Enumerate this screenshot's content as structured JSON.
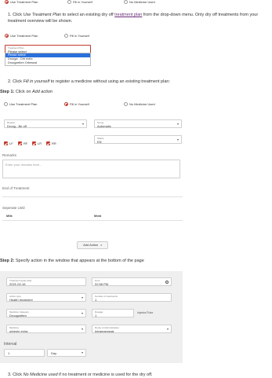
{
  "top_strip": {
    "opt_treatment": "Use Treatment Plan",
    "opt_fill": "Fill in Yourself",
    "opt_none": "No Medicine Used"
  },
  "step1_intro": {
    "num": "1.",
    "pre": "Click ",
    "em": "Use Treatment Plan",
    "mid": " to select an existing dry off ",
    "link": "treatment plan",
    "post": " from the drop-down menu. Only dry off treatments from your treatment overview will be shown."
  },
  "shot1": {
    "opt_treatment": "Use Treatment Plan",
    "opt_fill": "Fill in Yourself",
    "field_label": "Treatment Plan",
    "field_value": "Please select",
    "options": [
      "Please select",
      "Drooga . Orb extra",
      "Droogzetten Orbeseal"
    ],
    "selected_index": 0
  },
  "step2_intro": {
    "num": "2.",
    "pre": "Click ",
    "em": "Fill in yourself",
    "post": " to register a medicine without using an existing treatment plan:"
  },
  "step1_heading": {
    "bold": "Step 1:",
    "pre": " Click on ",
    "em": "Add action"
  },
  "shot2": {
    "opt_treatment": "Use Treatment Plan",
    "opt_fill": "Fill in Yourself",
    "opt_none": "No Medicine Used",
    "reason_label": "Reason",
    "reason_value": "Droog - Be off",
    "group_label": "Group",
    "group_value": "Automatic",
    "quarters": [
      "LF",
      "RF",
      "LR",
      "RR"
    ],
    "status_label": "Status",
    "status_value": "EN",
    "remarks_label": "Remarks",
    "remarks_placeholder": "Enter your remarks here...",
    "end_label": "End of Treatment",
    "separate_label": "Seperate Until",
    "milk_label": "Milk",
    "meat_label": "Meat",
    "add_action": "Add Action"
  },
  "step2_heading": {
    "bold": "Step 2:",
    "text": " Specify action in the window that appears at the bottom of the page"
  },
  "shot3": {
    "date_label": "Treatment apply date",
    "date_value": "2021-02-16",
    "hour_label": "Hour",
    "hour_value": "02:58 PM",
    "action_label": "Action type",
    "action_value": "Health treatment",
    "num_label": "Number of treatments",
    "num_value": "1",
    "category_label": "Medicine Category",
    "category_value": "Droogzetten",
    "dosage_label": "Dosage",
    "dosage_value": "1",
    "unit_value": "Injector/Tube",
    "medicine_label": "Medicine",
    "medicine_value": "orbenin extra",
    "route_label": "Route of Administration",
    "route_value": "Intramammair",
    "interval_label": "Interval",
    "interval_value": "1",
    "interval_unit": "Day"
  },
  "step3_intro": {
    "num": "3.",
    "pre": "Click ",
    "em": "No Medicine used",
    "post": " if no treatment or medicine is used for the dry off."
  }
}
